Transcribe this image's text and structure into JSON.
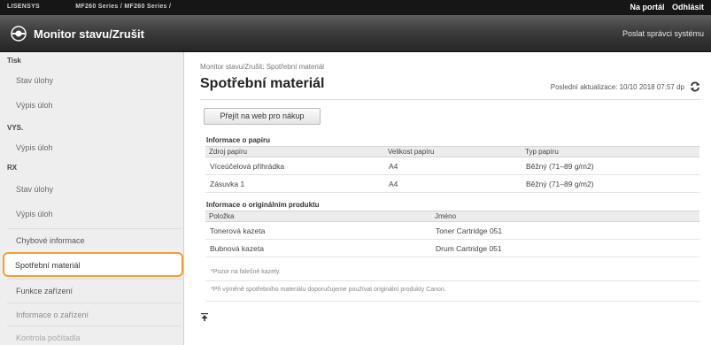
{
  "topbar": {
    "user": "LISENSYS",
    "model": "MF260 Series / MF260 Series /",
    "portal_link": "Na portál",
    "logout_link": "Odhlásit"
  },
  "header": {
    "title": "Monitor stavu/Zrušit",
    "mail_admin": "Poslat správci systému",
    "logo_icon": "canon-device-icon"
  },
  "sidebar": {
    "sections": [
      {
        "heading": "Tisk",
        "links": [
          "Stav úlohy",
          "Výpis úloh"
        ]
      },
      {
        "heading": "VYS.",
        "links": [
          "Výpis úloh"
        ]
      },
      {
        "heading": "RX",
        "links": [
          "Stav úlohy",
          "Výpis úloh"
        ]
      }
    ],
    "items": [
      {
        "label": "Chybové informace"
      },
      {
        "label": "Spotřební materiál"
      },
      {
        "label": "Funkce zařízení"
      },
      {
        "label": "Informace o zařízení"
      },
      {
        "label": "Kontrola počítadla"
      }
    ],
    "active_item": "Spotřební materiál"
  },
  "main": {
    "breadcrumb": "Monitor stavu/Zrušit: Spotřební materiál",
    "title": "Spotřební materiál",
    "last_update": "Poslední aktualizace: 10/10 2018 07:57 dp",
    "shop_button": "Přejít na web pro nákup",
    "paper": {
      "title": "Informace o papíru",
      "headers": [
        "Zdroj papíru",
        "Velikost papíru",
        "Typ papíru"
      ],
      "rows": [
        [
          "Víceúčelová přihrádka",
          "A4",
          "Běžný (71–89 g/m2)"
        ],
        [
          "Zásuvka 1",
          "A4",
          "Běžný (71–89 g/m2)"
        ]
      ]
    },
    "products": {
      "title": "Informace o originálním produktu",
      "headers": [
        "Položka",
        "Jméno"
      ],
      "rows": [
        [
          "Tonerová kazeta",
          "Toner Cartridge 051"
        ],
        [
          "Bubnová kazeta",
          "Drum Cartridge 051"
        ]
      ]
    },
    "note1": "*Pozor na falešné kazety.",
    "note2": "*Při výměně spotřebního materiálu doporučujeme používat originální produkty Canon.",
    "top_icon": "back-to-top-icon"
  },
  "colors": {
    "highlight": "#f0a033",
    "header_dark": "#262626"
  }
}
